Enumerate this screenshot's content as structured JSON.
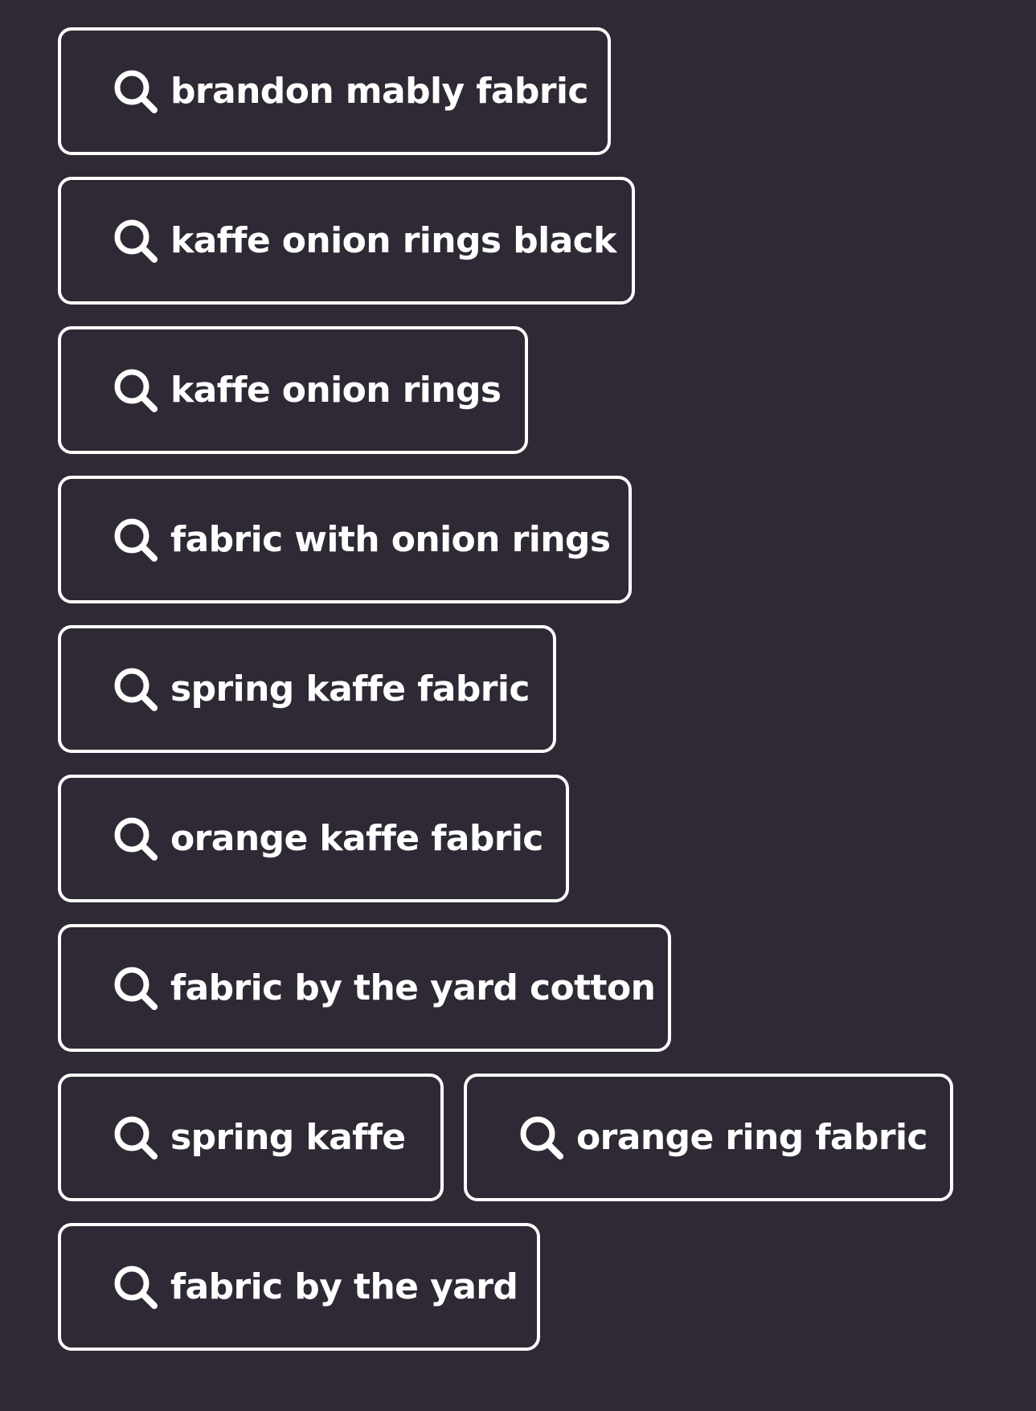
{
  "colors": {
    "background": "#2f2935",
    "chip_border": "#ffffff",
    "text": "#ffffff"
  },
  "search_suggestions": {
    "icon": "search-icon",
    "items": [
      {
        "label": "brandon mably fabric"
      },
      {
        "label": "kaffe onion rings black"
      },
      {
        "label": "kaffe onion rings"
      },
      {
        "label": "fabric with onion rings"
      },
      {
        "label": "spring kaffe fabric"
      },
      {
        "label": "orange kaffe fabric"
      },
      {
        "label": "fabric by the yard cotton"
      },
      {
        "label": "spring kaffe"
      },
      {
        "label": "orange ring fabric"
      },
      {
        "label": "fabric by the yard"
      }
    ]
  }
}
